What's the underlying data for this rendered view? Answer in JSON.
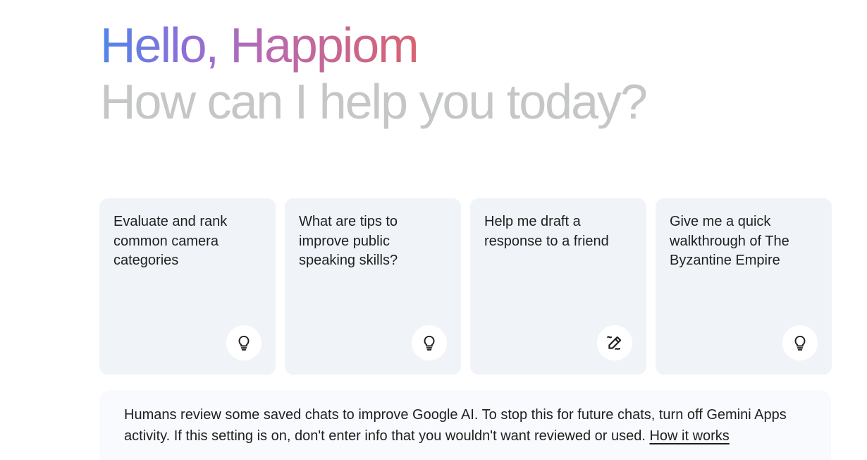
{
  "greeting": {
    "hello": "Hello, Happiom",
    "subtitle": "How can I help you today?"
  },
  "cards": [
    {
      "text": "Evaluate and rank common camera categories",
      "icon": "lightbulb-icon"
    },
    {
      "text": "What are tips to improve public speaking skills?",
      "icon": "lightbulb-icon"
    },
    {
      "text": "Help me draft a response to a friend",
      "icon": "pen-write-icon"
    },
    {
      "text": "Give me a quick walkthrough of The Byzantine Empire",
      "icon": "lightbulb-icon"
    }
  ],
  "notice": {
    "text": "Humans review some saved chats to improve Google AI. To stop this for future chats, turn off Gemini Apps activity. If this setting is on, don't enter info that you wouldn't want reviewed or used. ",
    "link": "How it works"
  },
  "colors": {
    "card_bg": "#f0f4f9",
    "notice_bg": "#f8fafd",
    "subtitle": "#c4c7c5",
    "gradient_start": "#4f86ec",
    "gradient_end": "#d8636f"
  }
}
